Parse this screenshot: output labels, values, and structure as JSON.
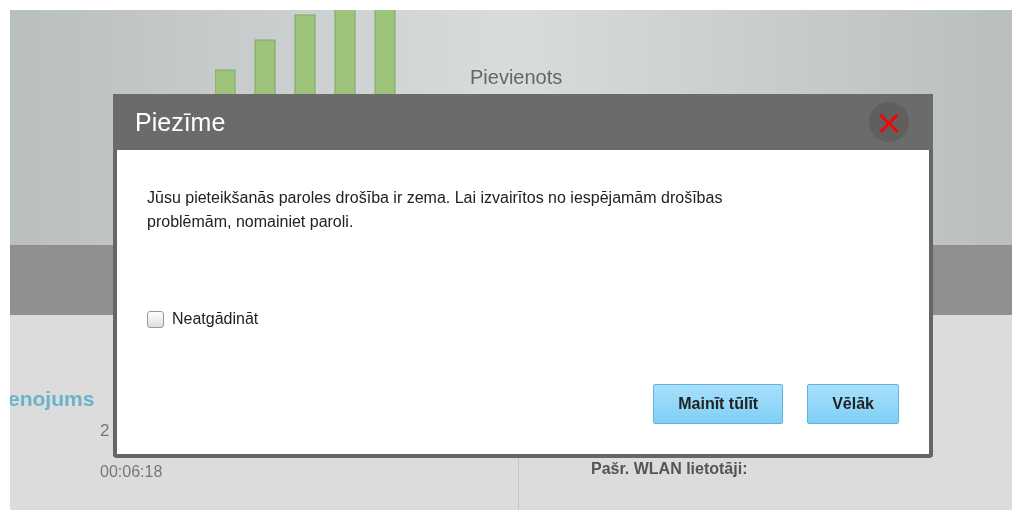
{
  "background": {
    "status": "Pievienots",
    "section_title": "enojums",
    "value_partial": "2",
    "uptime": "00:06:18",
    "wlan_users_label": "Pašr. WLAN lietotāji:"
  },
  "dialog": {
    "title": "Piezīme",
    "close": "×",
    "message": "Jūsu pieteikšanās paroles drošība ir zema. Lai izvairītos no iespējamām drošības problēmām, nomainiet paroli.",
    "checkbox": {
      "label": "Neatgādināt",
      "checked": false
    },
    "buttons": [
      "Mainīt tūlīt",
      "Vēlāk"
    ]
  }
}
